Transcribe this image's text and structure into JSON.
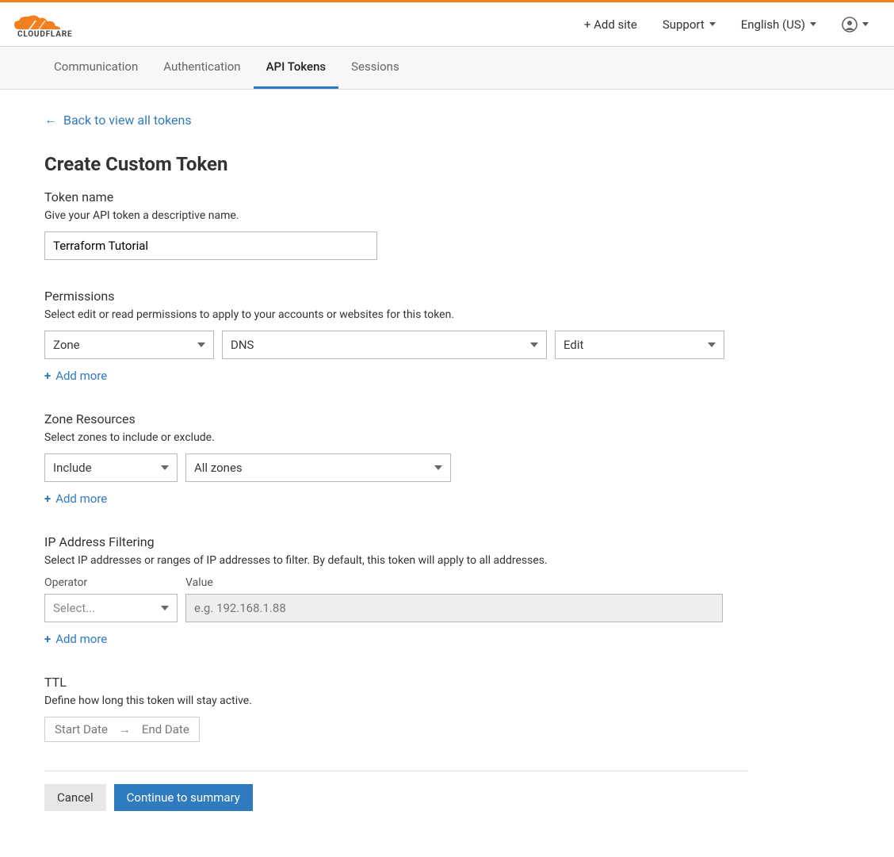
{
  "header": {
    "brand": "CLOUDFLARE",
    "add_site": "+ Add site",
    "support": "Support",
    "language": "English (US)"
  },
  "tabs": [
    {
      "label": "Communication",
      "active": false
    },
    {
      "label": "Authentication",
      "active": false
    },
    {
      "label": "API Tokens",
      "active": true
    },
    {
      "label": "Sessions",
      "active": false
    }
  ],
  "back_link": "Back to view all tokens",
  "title": "Create Custom Token",
  "token_name": {
    "label": "Token name",
    "desc": "Give your API token a descriptive name.",
    "value": "Terraform Tutorial"
  },
  "permissions": {
    "label": "Permissions",
    "desc": "Select edit or read permissions to apply to your accounts or websites for this token.",
    "scope": "Zone",
    "resource": "DNS",
    "access": "Edit",
    "add_more": "Add more"
  },
  "zone_resources": {
    "label": "Zone Resources",
    "desc": "Select zones to include or exclude.",
    "mode": "Include",
    "target": "All zones",
    "add_more": "Add more"
  },
  "ip_filtering": {
    "label": "IP Address Filtering",
    "desc": "Select IP addresses or ranges of IP addresses to filter. By default, this token will apply to all addresses.",
    "operator_label": "Operator",
    "value_label": "Value",
    "operator_placeholder": "Select...",
    "value_placeholder": "e.g. 192.168.1.88",
    "add_more": "Add more"
  },
  "ttl": {
    "label": "TTL",
    "desc": "Define how long this token will stay active.",
    "start": "Start Date",
    "end": "End Date"
  },
  "actions": {
    "cancel": "Cancel",
    "continue": "Continue to summary"
  }
}
